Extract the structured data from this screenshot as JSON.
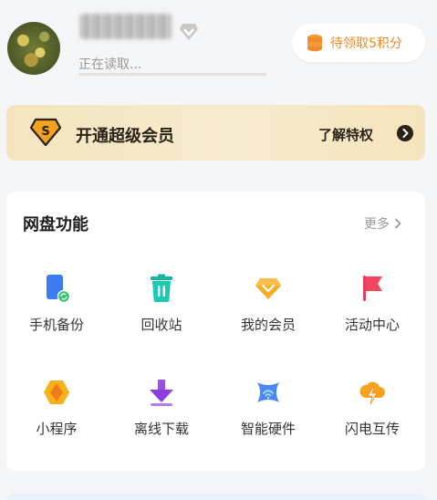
{
  "header": {
    "status": "正在读取...",
    "points_button": "待领取5积分"
  },
  "vip_banner": {
    "title": "开通超级会员",
    "link": "了解特权",
    "badge_letter": "S"
  },
  "features": {
    "title": "网盘功能",
    "more": "更多",
    "items": [
      {
        "label": "手机备份",
        "icon": "phone-backup-icon"
      },
      {
        "label": "回收站",
        "icon": "recycle-bin-icon"
      },
      {
        "label": "我的会员",
        "icon": "membership-icon"
      },
      {
        "label": "活动中心",
        "icon": "flag-icon"
      },
      {
        "label": "小程序",
        "icon": "mini-program-icon"
      },
      {
        "label": "离线下载",
        "icon": "download-icon"
      },
      {
        "label": "智能硬件",
        "icon": "smart-hardware-icon"
      },
      {
        "label": "闪电互传",
        "icon": "lightning-transfer-icon"
      }
    ]
  },
  "colors": {
    "accent_orange": "#f08a24",
    "vip_gold": "#f4e4be",
    "background": "#f4f5f7"
  }
}
